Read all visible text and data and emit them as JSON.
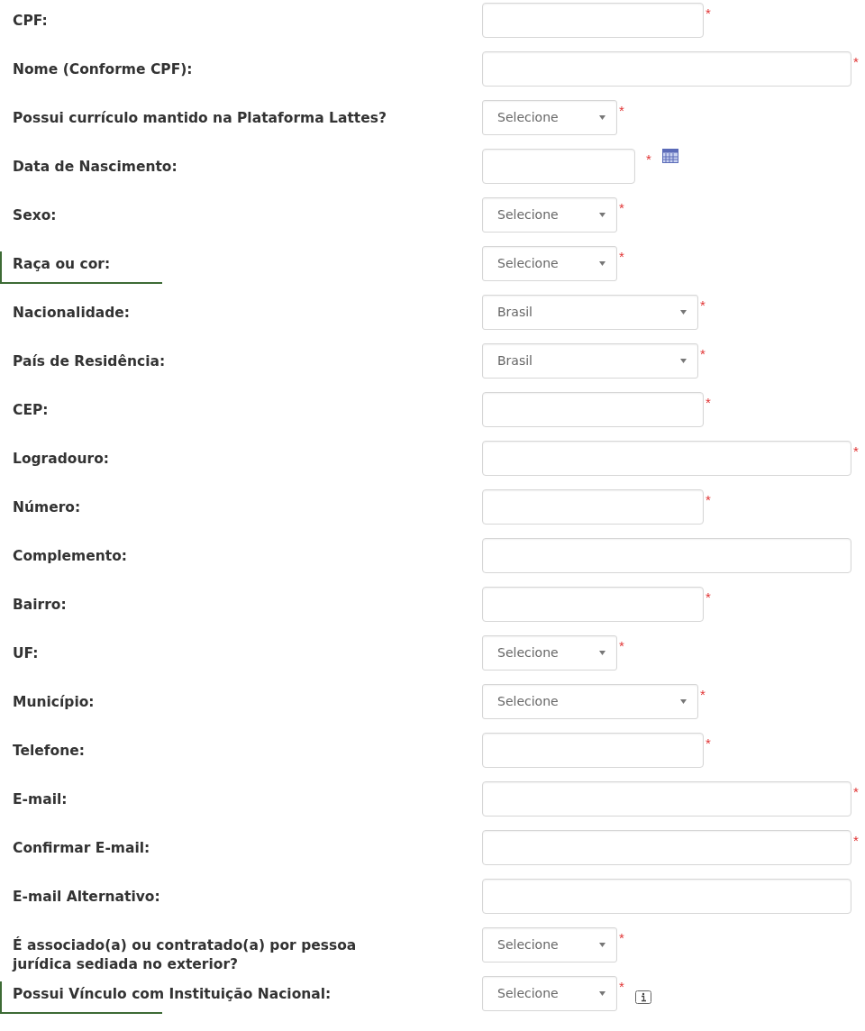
{
  "fields": [
    {
      "label": "CPF:",
      "kind": "text",
      "wide": false,
      "required_mark": "*",
      "highlighted": false
    },
    {
      "label": "Nome (Conforme CPF):",
      "kind": "text",
      "wide": true,
      "required_mark": "*",
      "highlighted": false
    },
    {
      "label": "Possui currículo mantido na Plataforma Lattes?",
      "kind": "select",
      "wide": false,
      "value": "Selecione",
      "required_mark": "*",
      "highlighted": false
    },
    {
      "label": "Data de Nascimento:",
      "kind": "date",
      "wide": false,
      "required_mark": "*",
      "highlighted": false
    },
    {
      "label": "Sexo:",
      "kind": "select",
      "wide": false,
      "value": "Selecione",
      "required_mark": "*",
      "highlighted": false
    },
    {
      "label": "Raça ou cor:",
      "kind": "select",
      "wide": false,
      "value": "Selecione",
      "required_mark": "*",
      "highlighted": true
    },
    {
      "label": "Nacionalidade:",
      "kind": "select",
      "wide": true,
      "value": "Brasil",
      "required_mark": "*",
      "highlighted": false
    },
    {
      "label": "País de Residência:",
      "kind": "select",
      "wide": true,
      "value": "Brasil",
      "required_mark": "*",
      "highlighted": false
    },
    {
      "label": "CEP:",
      "kind": "text",
      "wide": false,
      "required_mark": "*",
      "highlighted": false
    },
    {
      "label": "Logradouro:",
      "kind": "text",
      "wide": true,
      "required_mark": "*",
      "highlighted": false
    },
    {
      "label": "Número:",
      "kind": "text",
      "wide": false,
      "required_mark": "*",
      "highlighted": false
    },
    {
      "label": "Complemento:",
      "kind": "text",
      "wide": true,
      "highlighted": false
    },
    {
      "label": "Bairro:",
      "kind": "text",
      "wide": false,
      "required_mark": "*",
      "highlighted": false
    },
    {
      "label": "UF:",
      "kind": "select",
      "wide": false,
      "value": "Selecione",
      "required_mark": "*",
      "highlighted": false
    },
    {
      "label": "Município:",
      "kind": "select",
      "wide": true,
      "value": "Selecione",
      "required_mark": "*",
      "highlighted": false
    },
    {
      "label": "Telefone:",
      "kind": "text",
      "wide": false,
      "required_mark": "*",
      "highlighted": false
    },
    {
      "label": "E-mail:",
      "kind": "text",
      "wide": true,
      "required_mark": "*",
      "highlighted": false
    },
    {
      "label": "Confirmar E-mail:",
      "kind": "text",
      "wide": true,
      "required_mark": "*",
      "highlighted": false
    },
    {
      "label": "E-mail Alternativo:",
      "kind": "text",
      "wide": true,
      "highlighted": false
    },
    {
      "label": "É associado(a) ou contratado(a) por pessoa jurídica sediada no exterior?",
      "kind": "select",
      "wide": false,
      "value": "Selecione",
      "required_mark": "*",
      "highlighted": false
    },
    {
      "label": "Possui Vínculo com Instituição Nacional:",
      "kind": "select",
      "wide": false,
      "value": "Selecione",
      "required_mark": "*",
      "highlighted": true,
      "info": true
    }
  ]
}
